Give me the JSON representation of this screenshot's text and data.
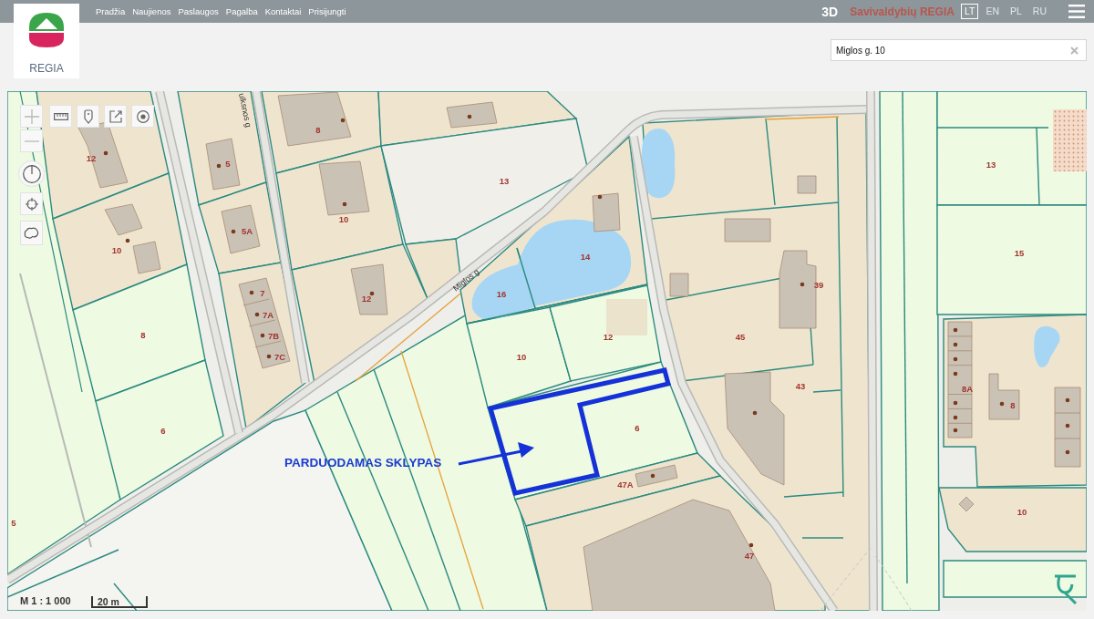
{
  "header": {
    "logo_text": "REGIA",
    "nav": [
      "Pradžia",
      "Naujienos",
      "Paslaugos",
      "Pagalba",
      "Kontaktai",
      "Prisijungti"
    ],
    "mode_button": "3D",
    "brand": "Savivaldybių REGIA",
    "languages": [
      {
        "label": "LT",
        "selected": true
      },
      {
        "label": "EN",
        "selected": false
      },
      {
        "label": "PL",
        "selected": false
      },
      {
        "label": "RU",
        "selected": false
      }
    ]
  },
  "search": {
    "value": "Miglos g. 10"
  },
  "map": {
    "streets": [
      "ulksnos g",
      "Miglos g"
    ],
    "parcel_numbers": [
      "8",
      "12",
      "5",
      "13",
      "13",
      "10",
      "5A",
      "10",
      "14",
      "15",
      "7",
      "12",
      "16",
      "7A",
      "8",
      "12",
      "10",
      "45",
      "39",
      "7B",
      "7C",
      "8A",
      "43",
      "8",
      "6",
      "6",
      "47A",
      "10",
      "5",
      "47"
    ],
    "annotation": {
      "text": "PARDUODAMAS SKLYPAS"
    },
    "scale": {
      "ratio": "M 1 : 1 000",
      "bar_label": "20 m"
    }
  }
}
